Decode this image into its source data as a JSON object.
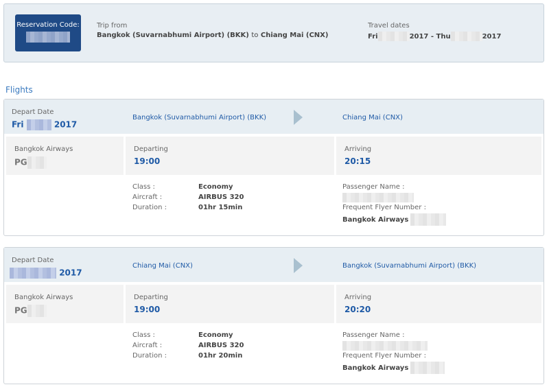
{
  "summary": {
    "reservation_label": "Reservation Code:",
    "trip_label": "Trip from",
    "trip_origin": "Bangkok (Suvarnabhumi Airport) (BKK)",
    "trip_to_word": "to",
    "trip_destination": "Chiang Mai (CNX)",
    "dates_label": "Travel dates",
    "date_start_day": "Fri",
    "date_start_year": "2017 -",
    "date_end_day": "Thu",
    "date_end_year": "2017"
  },
  "flights_title": "Flights",
  "flights": [
    {
      "depart_date_label": "Depart Date",
      "depart_day": "Fri",
      "depart_year": "2017",
      "from": "Bangkok (Suvarnabhumi Airport) (BKK)",
      "to": "Chiang Mai (CNX)",
      "airline": "Bangkok Airways",
      "flight_prefix": "PG",
      "departing_label": "Departing",
      "departing_time": "19:00",
      "arriving_label": "Arriving",
      "arriving_time": "20:15",
      "class_label": "Class :",
      "class_value": "Economy",
      "aircraft_label": "Aircraft :",
      "aircraft_value": "AIRBUS 320",
      "duration_label": "Duration :",
      "duration_value": "01hr 15min",
      "passenger_label": "Passenger Name :",
      "ffn_label": "Frequent Flyer Number :",
      "ffn_airline": "Bangkok Airways"
    },
    {
      "depart_date_label": "Depart Date",
      "depart_day": "",
      "depart_year": "2017",
      "from": "Chiang Mai (CNX)",
      "to": "Bangkok (Suvarnabhumi Airport) (BKK)",
      "airline": "Bangkok Airways",
      "flight_prefix": "PG",
      "departing_label": "Departing",
      "departing_time": "19:00",
      "arriving_label": "Arriving",
      "arriving_time": "20:20",
      "class_label": "Class :",
      "class_value": "Economy",
      "aircraft_label": "Aircraft :",
      "aircraft_value": "AIRBUS 320",
      "duration_label": "Duration :",
      "duration_value": "01hr 20min",
      "passenger_label": "Passenger Name :",
      "ffn_label": "Frequent Flyer Number :",
      "ffn_airline": "Bangkok Airways"
    }
  ]
}
